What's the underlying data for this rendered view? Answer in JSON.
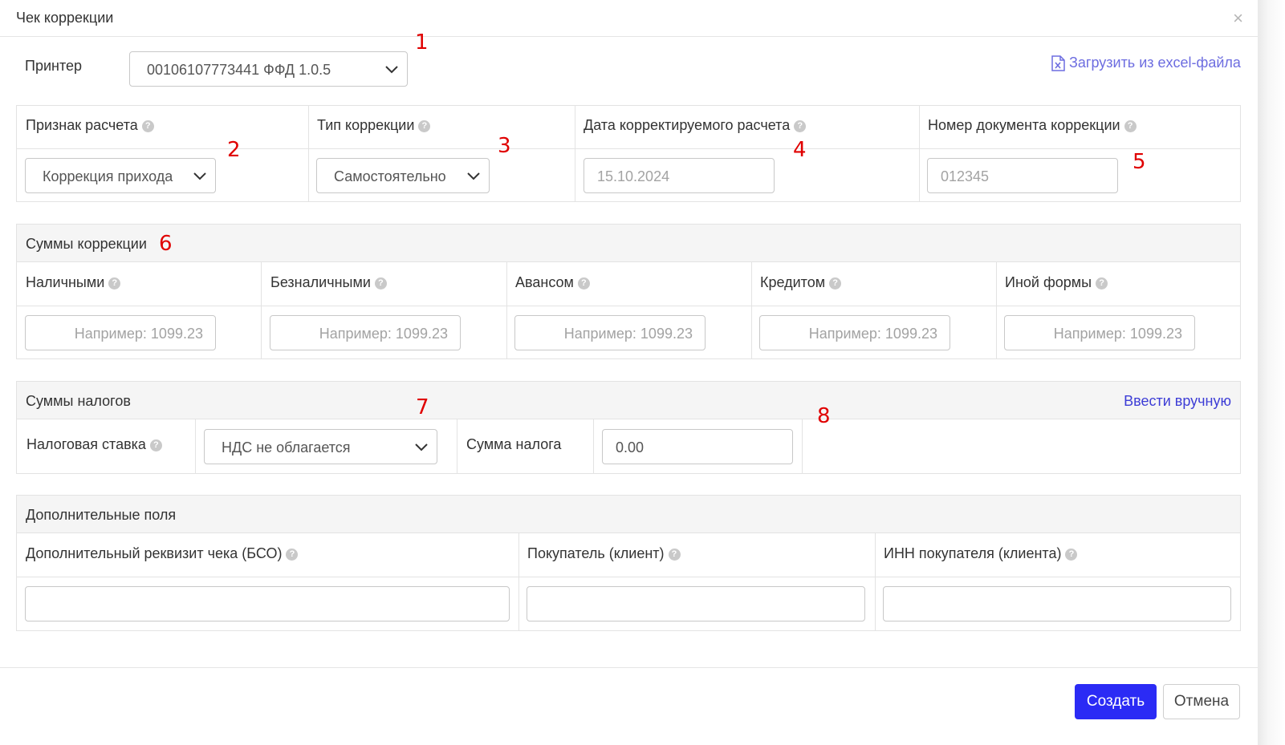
{
  "dialog": {
    "title": "Чек коррекции",
    "close": "×"
  },
  "printer": {
    "label": "Принтер",
    "value": "00106107773441 ФФД 1.0.5"
  },
  "excel_link": "Загрузить из excel-файла",
  "annotations": [
    "1",
    "2",
    "3",
    "4",
    "5",
    "6",
    "7",
    "8"
  ],
  "params": {
    "sign_label": "Признак расчета",
    "sign_value": "Коррекция прихода",
    "type_label": "Тип коррекции",
    "type_value": "Самостоятельно",
    "date_label": "Дата корректируемого расчета",
    "date_placeholder": "15.10.2024",
    "docnum_label": "Номер документа коррекции",
    "docnum_placeholder": "012345"
  },
  "sums": {
    "title": "Суммы коррекции",
    "placeholder": "Например: 1099.23",
    "columns": [
      "Наличными",
      "Безналичными",
      "Авансом",
      "Кредитом",
      "Иной формы"
    ]
  },
  "taxes": {
    "title": "Суммы налогов",
    "manual_link": "Ввести вручную",
    "rate_label": "Налоговая ставка",
    "rate_value": "НДС не облагается",
    "amount_label": "Сумма налога",
    "amount_value": "0.00"
  },
  "extra": {
    "title": "Дополнительные поля",
    "bso_label": "Дополнительный реквизит чека (БСО)",
    "buyer_label": "Покупатель (клиент)",
    "inn_label": "ИНН покупателя (клиента)"
  },
  "footer": {
    "create": "Создать",
    "cancel": "Отмена"
  },
  "colors": {
    "accent": "#2b2bf5",
    "link": "#3d3dd6",
    "annotation": "#e00000"
  }
}
